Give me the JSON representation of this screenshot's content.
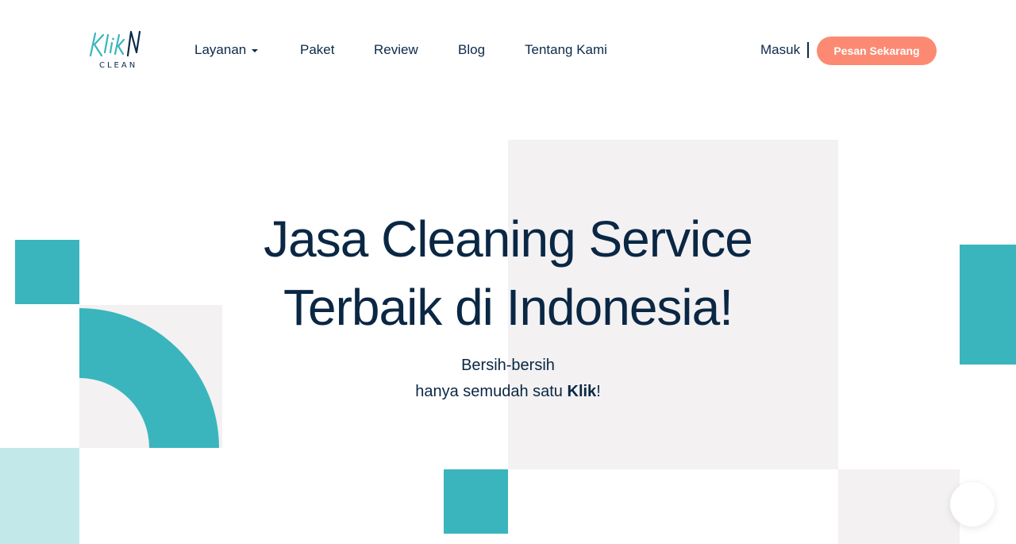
{
  "brand": {
    "logo_script": "Klik",
    "logo_sub": "CLEAN",
    "colors": {
      "navy": "#0b2a4a",
      "teal": "#3ab5bd",
      "coral": "#fc8a73",
      "light_grey": "#f3f1f2",
      "pale_teal": "#c3e8ea"
    }
  },
  "nav": {
    "items": [
      {
        "label": "Layanan",
        "has_dropdown": true
      },
      {
        "label": "Paket"
      },
      {
        "label": "Review"
      },
      {
        "label": "Blog"
      },
      {
        "label": "Tentang Kami"
      }
    ],
    "login_label": "Masuk",
    "separator": "|",
    "cta_label": "Pesan Sekarang",
    "dropdown_icon": "caret-down-icon"
  },
  "hero": {
    "title_line1": "Jasa Cleaning Service",
    "title_line2": "Terbaik di Indonesia!",
    "subtitle_line1": "Bersih-bersih",
    "subtitle_line2_prefix": "hanya semudah satu ",
    "subtitle_line2_bold": "Klik",
    "subtitle_line2_suffix": "!"
  },
  "widgets": {
    "chat_icon": "chat-bubble-icon"
  }
}
